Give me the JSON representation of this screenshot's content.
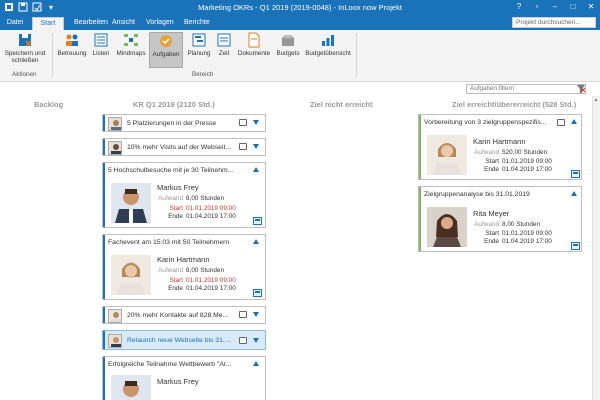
{
  "window": {
    "title": "Marketing OKRs - Q1 2019 (2019-0048) - InLoox now Projekt"
  },
  "tabs": [
    {
      "label": "Datei"
    },
    {
      "label": "Start"
    },
    {
      "label": "Bearbeiten"
    },
    {
      "label": "Ansicht"
    },
    {
      "label": "Vorlagen"
    },
    {
      "label": "Berichte"
    }
  ],
  "project_search": {
    "placeholder": "Projekt durchsuchen..."
  },
  "ribbon": {
    "save_close": "Speichern und schließen",
    "group_actions": "Aktionen",
    "group_area": "Bereich",
    "buttons": [
      {
        "label": "Betreuung"
      },
      {
        "label": "Listen"
      },
      {
        "label": "Mindmaps"
      },
      {
        "label": "Aufgaben"
      },
      {
        "label": "Planung"
      },
      {
        "label": "Zeit"
      },
      {
        "label": "Dokumente"
      },
      {
        "label": "Budgets"
      },
      {
        "label": "Budgetübersicht"
      }
    ]
  },
  "filter": {
    "placeholder": "Aufgaben filtern"
  },
  "columns": [
    {
      "title": "Backlog"
    },
    {
      "title": "KR Q1 2019 (2120 Std.)"
    },
    {
      "title": "Ziel nicht erreicht"
    },
    {
      "title": "Ziel erreicht/übererreicht (528 Std.)"
    }
  ],
  "labels": {
    "aufwand": "Aufwand",
    "start": "Start",
    "ende": "Ende"
  },
  "kr_cards": [
    {
      "title": "5 Platzierungen in der Presse"
    },
    {
      "title": "10% mehr Visits auf der Webseit..."
    },
    {
      "title": "5 Hochschulbesuche mit je 30 Teilnehm...",
      "person": "Markus Frey",
      "aufwand": "8,00 Stunden",
      "start": "01.01.2019 09:00",
      "ende": "01.04.2019 17:00"
    },
    {
      "title": "Fachevent am 15.03 mit 50 Teilnehmern",
      "person": "Karin Hartmann",
      "aufwand": "8,00 Stunden",
      "start": "01.01.2019 09:00",
      "ende": "01.04.2019 17:00"
    },
    {
      "title": "20% mehr Kontakte auf 828 Me..."
    },
    {
      "title": "Relaunch neue Webseite bis 31...."
    },
    {
      "title": "Erfolgreiche Teilnahme Wettbewerb \"Ar...",
      "person": "Markus Frey"
    }
  ],
  "done_cards": [
    {
      "title": "Vorbereitung von 3 zielgruppenspezifis...",
      "person": "Karin Hartmann",
      "aufwand": "520,00 Stunden",
      "start": "01.01.2019 09:00",
      "ende": "01.04.2019 17:00"
    },
    {
      "title": "Zielgruppenanalyse bis 31.01.2019",
      "person": "Rita Meyer",
      "aufwand": "8,00 Stunden",
      "start": "01.01.2019 09:00",
      "ende": "01.04.2019 17:00"
    }
  ],
  "colors": {
    "accent": "#1a73b8",
    "green": "#79b95b",
    "start_red": "#c0392b"
  }
}
